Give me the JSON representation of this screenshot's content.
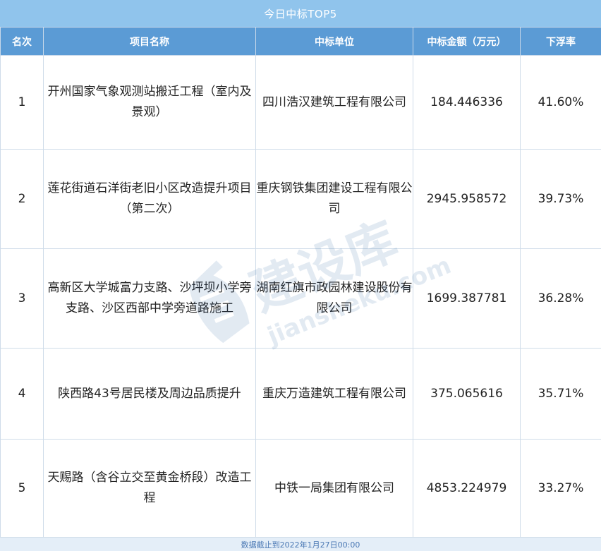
{
  "title": "今日中标TOP5",
  "columns": [
    "名次",
    "项目名称",
    "中标单位",
    "中标金额（万元）",
    "下浮率"
  ],
  "rows": [
    {
      "rank": "1",
      "project": "开州国家气象观测站搬迁工程（室内及景观）",
      "winner": "四川浩汉建筑工程有限公司",
      "amount": "184.446336",
      "rate": "41.60%"
    },
    {
      "rank": "2",
      "project": "莲花街道石洋街老旧小区改造提升项目（第二次）",
      "winner": "重庆钢铁集团建设工程有限公司",
      "amount": "2945.958572",
      "rate": "39.73%"
    },
    {
      "rank": "3",
      "project": "高新区大学城富力支路、沙坪坝小学旁支路、沙区西部中学旁道路施工",
      "winner": "湖南红旗市政园林建设股份有限公司",
      "amount": "1699.387781",
      "rate": "36.28%"
    },
    {
      "rank": "4",
      "project": "陕西路43号居民楼及周边品质提升",
      "winner": "重庆万造建筑工程有限公司",
      "amount": "375.065616",
      "rate": "35.71%"
    },
    {
      "rank": "5",
      "project": "天赐路（含谷立交至黄金桥段）改造工程",
      "winner": "中铁一局集团有限公司",
      "amount": "4853.224979",
      "rate": "33.27%"
    }
  ],
  "footer": "数据截止到2022年1月27日00:00",
  "watermark": {
    "text_cn": "建设库",
    "text_en": "jiansheku.com"
  },
  "colors": {
    "title_bg": "#90c4ec",
    "header_bg": "#5b9bd5",
    "footer_bg": "#e4eef8",
    "footer_text": "#4a78b4"
  }
}
